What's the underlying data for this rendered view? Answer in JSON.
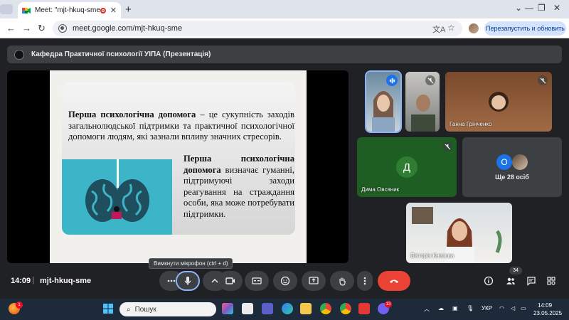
{
  "browser": {
    "tab_title": "Meet: \"mjt-hkuq-sme\"",
    "url": "meet.google.com/mjt-hkuq-sme",
    "relaunch_label": "Перезапустить и обновить"
  },
  "meeting": {
    "presenter_label": "Кафедра Практичної психології УІПА (Презентація)",
    "time": "14:09",
    "separator": "|",
    "code": "mjt-hkuq-sme",
    "mic_tooltip": "Вимкнути мікрофон (ctrl + d)",
    "participants_count": "34"
  },
  "slide": {
    "p1_bold": "Перша психологічна допомога",
    "p1_text": " – це сукупність заходів загальнолюдської підтримки та практичної психологічної допомоги людям, які зазнали впливу значних стресорів.",
    "p2_bold": "Перша психологічна допомога",
    "p2_text": " визначає гуманні, підтримуючі заходи реагування на страждання особи, яка може потребувати підтримки."
  },
  "tiles": {
    "hanna": "Ганна Грінченко",
    "dyma": "Дима Овсяник",
    "dyma_initial": "Д",
    "more_initial": "О",
    "more_label": "Ще 28 осіб",
    "viktoria": "Вікторія Князєва"
  },
  "taskbar": {
    "search_placeholder": "Пошук",
    "lang": "УКР",
    "time": "14:09",
    "date": "23.05.2025",
    "weather_badge": "1",
    "viber_badge": "13"
  },
  "colors": {
    "meet_bg": "#202124",
    "end_call": "#ea4335",
    "accent": "#1a73e8"
  }
}
